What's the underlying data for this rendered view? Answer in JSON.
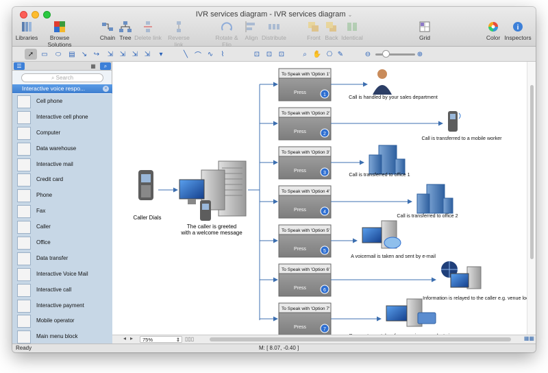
{
  "window": {
    "title": "IVR services diagram - IVR services diagram"
  },
  "toolbar": {
    "libraries": "Libraries",
    "browse_solutions": "Browse Solutions",
    "chain": "Chain",
    "tree": "Tree",
    "delete_link": "Delete link",
    "reverse_link": "Reverse link",
    "rotate_flip": "Rotate & Flip",
    "align": "Align",
    "distribute": "Distribute",
    "front": "Front",
    "back": "Back",
    "identical": "Identical",
    "grid": "Grid",
    "color": "Color",
    "inspectors": "Inspectors"
  },
  "sidebar": {
    "search_placeholder": "Search",
    "library_title": "Interactive voice respo...",
    "items": [
      "Cell phone",
      "Interactive cell phone",
      "Computer",
      "Data warehouse",
      "Interactive mail",
      "Credit card",
      "Phone",
      "Fax",
      "Caller",
      "Office",
      "Data transfer",
      "Interactive Voice Mail",
      "Interactive call",
      "Interactive payment",
      "Mobile operator",
      "Main menu block"
    ]
  },
  "diagram": {
    "caller_label": "Caller Dials",
    "greeting_label_1": "The caller is greeted",
    "greeting_label_2": "with a welcome message",
    "press": "Press",
    "options": [
      {
        "title": "To Speak with 'Option 1'",
        "num": "1",
        "result": "Call is handled by your sales department"
      },
      {
        "title": "To Speak with 'Option 2'",
        "num": "2",
        "result": "Call is transferred to a mobile worker"
      },
      {
        "title": "To Speak with 'Option 3'",
        "num": "3",
        "result": "Call is transferred to office 1"
      },
      {
        "title": "To Speak with 'Option 4'",
        "num": "4",
        "result": "Call is transferred to office 2"
      },
      {
        "title": "To Speak with 'Option 5'",
        "num": "5",
        "result": "A voicemail is taken and sent by e-mail"
      },
      {
        "title": "To Speak with 'Option 6'",
        "num": "6",
        "result": "Information is relayed to the caller e.g. venue locations"
      },
      {
        "title": "To Speak with 'Option 7'",
        "num": "7",
        "result": "Payments are taken for a service or product via our secure server"
      }
    ]
  },
  "bottom": {
    "zoom": "75%"
  },
  "status": {
    "ready": "Ready",
    "coords": "M: [ 8.07, -0.40 ]"
  },
  "colors": {
    "accent": "#3d80d8",
    "option_box": "#8e8e8e",
    "connector": "#3d6fb0"
  }
}
